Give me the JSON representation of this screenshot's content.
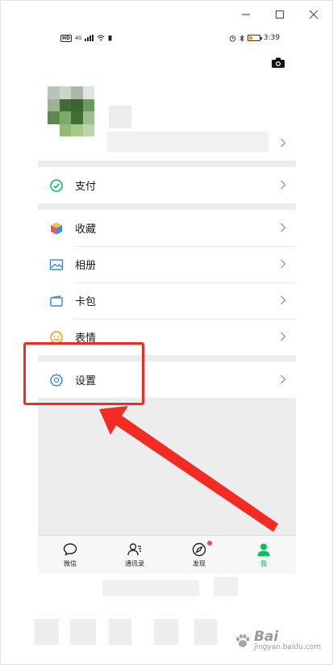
{
  "status_bar": {
    "time": "3:39",
    "hd_label": "HD",
    "network_label": "4G"
  },
  "menu": {
    "pay": {
      "label": "支付",
      "icon": "pay-check-icon"
    },
    "favorites": {
      "label": "收藏",
      "icon": "favorites-cube-icon"
    },
    "album": {
      "label": "相册",
      "icon": "album-photo-icon"
    },
    "cards": {
      "label": "卡包",
      "icon": "card-wallet-icon"
    },
    "stickers": {
      "label": "表情",
      "icon": "sticker-smile-icon"
    },
    "settings": {
      "label": "设置",
      "icon": "settings-gear-icon"
    }
  },
  "tabs": [
    {
      "label": "微信",
      "icon": "chat-bubble-icon",
      "active": false
    },
    {
      "label": "通讯录",
      "icon": "contacts-icon",
      "active": false
    },
    {
      "label": "发现",
      "icon": "discover-compass-icon",
      "active": false,
      "badge_dot": true
    },
    {
      "label": "我",
      "icon": "me-person-icon",
      "active": true
    }
  ],
  "watermark": {
    "brand": "Bai",
    "sub": "jingyan.baidu.com"
  },
  "colors": {
    "accent": "#07c160",
    "annotation": "#f22c22",
    "badge": "#f04a4a"
  }
}
